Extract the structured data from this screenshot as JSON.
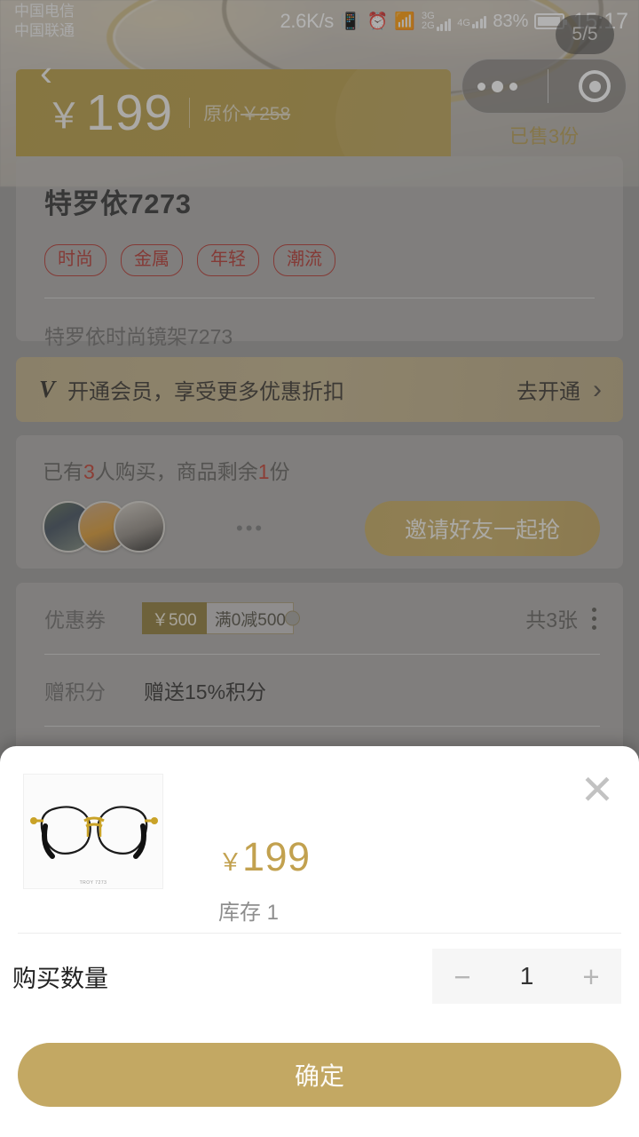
{
  "status_bar": {
    "carrier_1": "中国电信",
    "carrier_2": "中国联通",
    "net_speed": "2.6K/s",
    "sim1_tag_top": "3G",
    "sim1_tag_bottom": "2G",
    "sim2_tag": "4G",
    "battery_percent": "83%",
    "clock": "15:17",
    "vibrate_icon": "vibrate-icon",
    "alarm_icon": "alarm-icon",
    "wifi_icon": "wifi-icon"
  },
  "image_counter": "5/5",
  "capsule": {
    "menu_icon": "more-dots-icon",
    "target_icon": "target-icon"
  },
  "nav": {
    "back_icon": "back-chevron-icon"
  },
  "price_banner": {
    "currency": "￥",
    "price": "199",
    "original_label": "原价",
    "original_currency": "￥",
    "original_price": "258",
    "sold_text": "已售3份"
  },
  "product": {
    "title": "特罗依7273",
    "tags": [
      "时尚",
      "金属",
      "年轻",
      "潮流"
    ],
    "description": "特罗依时尚镜架7273"
  },
  "member_banner": {
    "badge": "V",
    "text": "开通会员，享受更多优惠折扣",
    "cta": "去开通",
    "chevron": "›"
  },
  "group_buy": {
    "line_prefix": "已有",
    "buyers_count": "3",
    "line_middle": "人购买，商品剩余",
    "remaining_count": "1",
    "line_suffix": "份",
    "more_dots": "•••",
    "invite_button": "邀请好友一起抢"
  },
  "promo": {
    "coupon_label": "优惠券",
    "coupon_value": "￥500",
    "coupon_rule": "满0减500",
    "coupon_count": "共3张",
    "points_label": "赠积分",
    "points_value": "赠送15%积分"
  },
  "sheet": {
    "close_icon": "close-icon",
    "thumb_caption": "TROY 7273",
    "currency": "￥",
    "price": "199",
    "stock": "库存 1",
    "qty_label": "购买数量",
    "minus": "−",
    "quantity": "1",
    "plus": "+",
    "confirm_label": "确定"
  },
  "colors": {
    "gold": "#c3a863",
    "banner_gold": "#b6993f",
    "tag_red": "#b2332c",
    "accent_red": "#c03a2b",
    "coupon_dark": "#8c7734",
    "sheet_bg": "#ffffff"
  }
}
